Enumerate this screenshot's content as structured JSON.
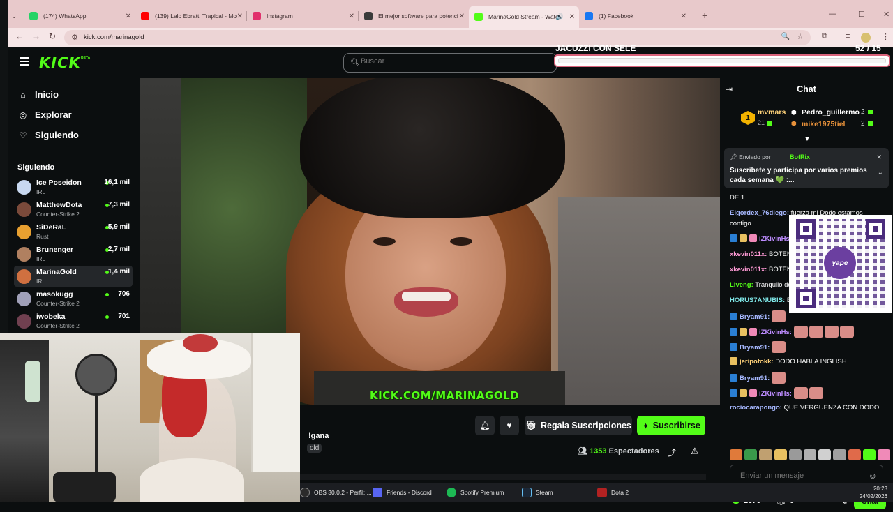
{
  "browser": {
    "tabs": [
      {
        "title": "(174) WhatsApp",
        "color": "#25d366"
      },
      {
        "title": "(139) Lalo Ebratt, Trapical - Mo",
        "color": "#ff0000"
      },
      {
        "title": "Instagram",
        "color": "#e1306c"
      },
      {
        "title": "El mejor software para potenci",
        "color": "#3a3a3a"
      },
      {
        "title": "MarinaGold Stream - Watc",
        "color": "#53fc18"
      },
      {
        "title": "(1) Facebook",
        "color": "#1877f2"
      }
    ],
    "url": "kick.com/marinagold"
  },
  "kick": {
    "search_placeholder": "Buscar",
    "goal": {
      "title": "JACUZZI CON SELE",
      "current": "52",
      "target": "/ 15"
    }
  },
  "sidebar": {
    "nav": [
      {
        "label": "Inicio",
        "icon": "home-icon",
        "glyph": "⌂"
      },
      {
        "label": "Explorar",
        "icon": "compass-icon",
        "glyph": "◎"
      },
      {
        "label": "Siguiendo",
        "icon": "heart-icon",
        "glyph": "♡"
      }
    ],
    "section_title": "Siguiendo",
    "following": [
      {
        "name": "Ice Poseidon",
        "category": "IRL",
        "viewers": "16,1 mil",
        "color": "#c8d8f0"
      },
      {
        "name": "MatthewDota",
        "category": "Counter-Strike 2",
        "viewers": "7,3 mil",
        "color": "#7a4a3a"
      },
      {
        "name": "SiDeRaL",
        "category": "Rust",
        "viewers": "5,9 mil",
        "color": "#e8a030"
      },
      {
        "name": "Brunenger",
        "category": "IRL",
        "viewers": "2,7 mil",
        "color": "#b08060"
      },
      {
        "name": "MarinaGold",
        "category": "IRL",
        "viewers": "1,4 mil",
        "color": "#d07040"
      },
      {
        "name": "masokugg",
        "category": "Counter-Strike 2",
        "viewers": "706",
        "color": "#a0a0b8"
      },
      {
        "name": "iwobeka",
        "category": "Counter-Strike 2",
        "viewers": "701",
        "color": "#704050"
      }
    ]
  },
  "video": {
    "watermark": "KICK.COM/MARINAGOLD"
  },
  "stream": {
    "title_partial": "!gana",
    "tag_partial": "old",
    "gift_label": "Regala Suscripciones",
    "subscribe_label": "Suscribirse",
    "viewers_count": "1353",
    "viewers_label": "Espectadores"
  },
  "chat": {
    "title": "Chat",
    "leaderboard": [
      {
        "rank": "1",
        "name": "mvmars",
        "value": "21"
      },
      {
        "name": "Pedro_guillermo",
        "value": "2"
      },
      {
        "name": "mike1975tiel",
        "value": "2"
      }
    ],
    "pinned": {
      "sent_by": "Enviado por",
      "bot": "BotRix",
      "message": "Suscribete y participa por varios premios cada semana 💚 :..."
    },
    "messages": [
      {
        "user": "",
        "text": "DE 1",
        "color": "#ffffff"
      },
      {
        "user": "Elgordex_76diego:",
        "text": "fuerza mi Dodo estamos",
        "color": "#a7b8ff"
      },
      {
        "user": "",
        "text": "contigo",
        "color": "#ffffff"
      },
      {
        "user": "iZKivinHs:",
        "text": "",
        "color": "#bd8cff"
      },
      {
        "user": "xkevin011x:",
        "text": "BOTEN A",
        "color": "#ff9ad5"
      },
      {
        "user": "xkevin011x:",
        "text": "BOTEN A",
        "color": "#ff9ad5"
      },
      {
        "user": "Liveng:",
        "text": "Tranquilo doo",
        "color": "#53fc18"
      },
      {
        "user": "HORUS7ANUBIS:",
        "text": "BOT",
        "color": "#7ee6e6"
      },
      {
        "user": "Bryam91:",
        "text": "",
        "color": "#a7b8ff"
      },
      {
        "user": "iZKivinHs:",
        "text": "",
        "color": "#bd8cff"
      },
      {
        "user": "Bryam91:",
        "text": "",
        "color": "#a7b8ff"
      },
      {
        "user": "jeripotokk:",
        "text": "DODO HABLA INGLISH",
        "color": "#ffd27a"
      },
      {
        "user": "Bryam91:",
        "text": "",
        "color": "#a7b8ff"
      },
      {
        "user": "iZKivinHs:",
        "text": "",
        "color": "#bd8cff"
      },
      {
        "user": "rociocarapongo:",
        "text": "QUE VERGUENZA CON DODO",
        "color": "#a7b8ff"
      }
    ],
    "qr_brand": "yape",
    "input_placeholder": "Enviar un mensaje",
    "points": "2370",
    "gifts": "0",
    "send_label": "Chat"
  },
  "taskbar": {
    "items": [
      {
        "label": "OBS 30.0.2 - Perfil: ...",
        "color": "#2b2b2b"
      },
      {
        "label": "Friends - Discord",
        "color": "#5865f2"
      },
      {
        "label": "Spotify Premium",
        "color": "#1db954"
      },
      {
        "label": "Steam",
        "color": "#1b2838"
      },
      {
        "label": "Dota 2",
        "color": "#b22222"
      }
    ],
    "time": "20:23",
    "date": "24/02/2026"
  }
}
